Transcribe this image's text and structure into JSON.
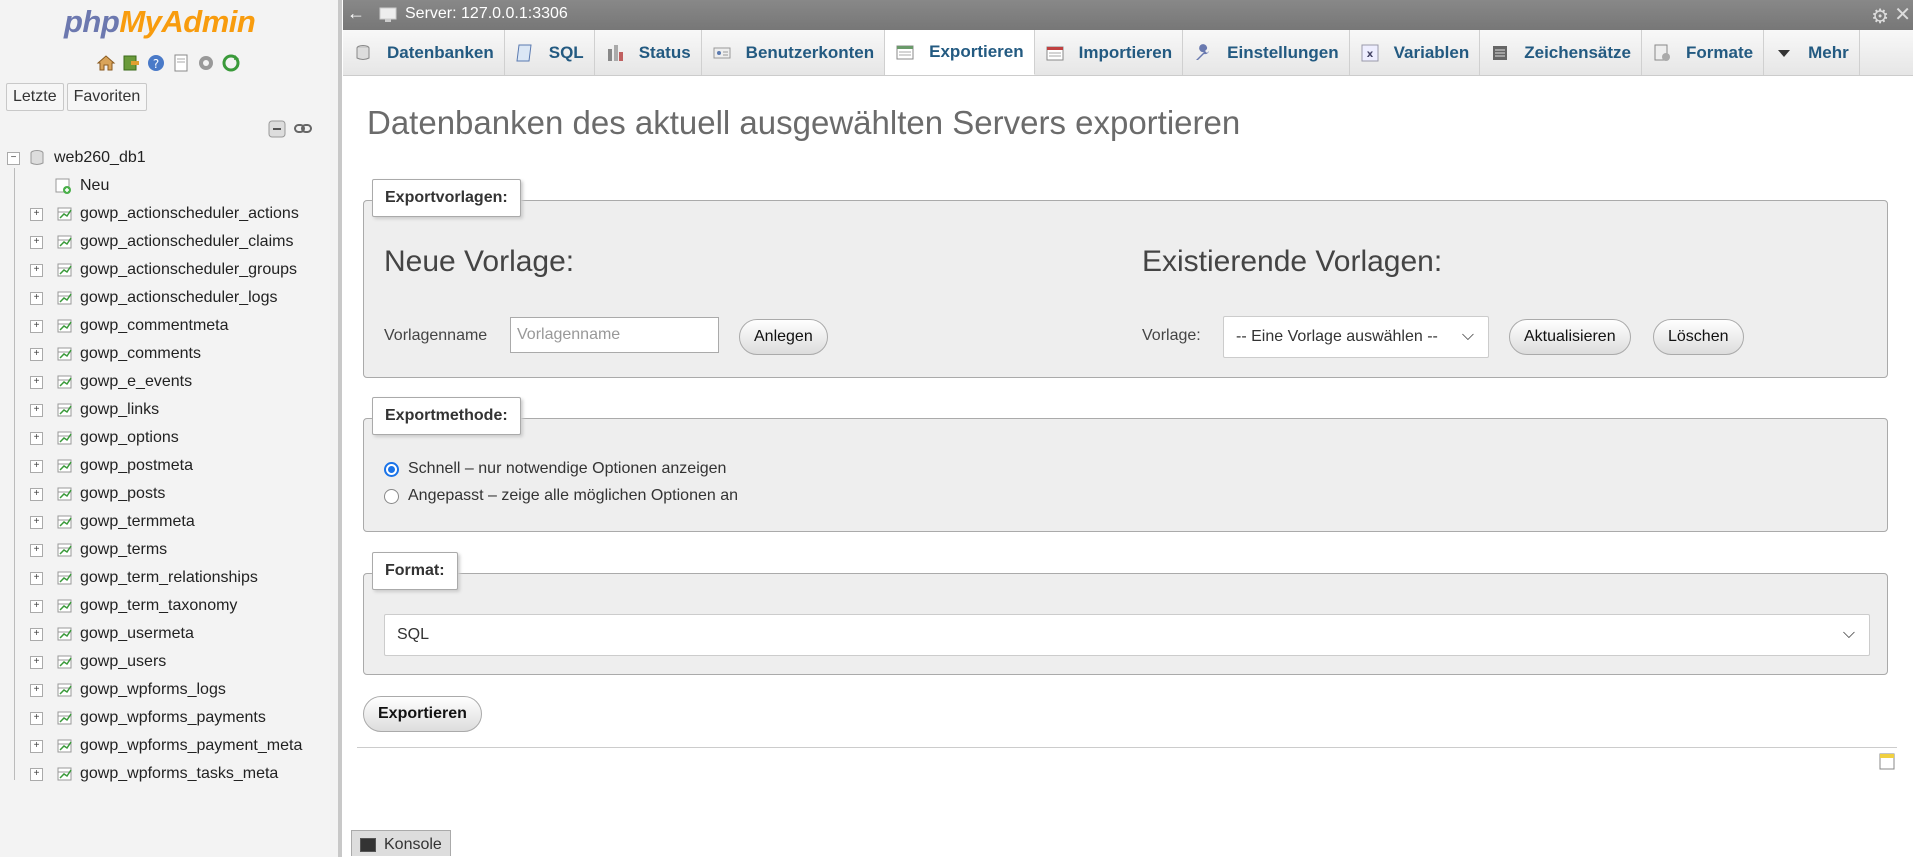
{
  "navigation": {
    "logo": {
      "part1": "php",
      "part2": "MyAdmin"
    },
    "tabs": [
      "Letzte",
      "Favoriten"
    ],
    "database": "web260_db1",
    "new_label": "Neu",
    "tables": [
      "gowp_actionscheduler_actions",
      "gowp_actionscheduler_claims",
      "gowp_actionscheduler_groups",
      "gowp_actionscheduler_logs",
      "gowp_commentmeta",
      "gowp_comments",
      "gowp_e_events",
      "gowp_links",
      "gowp_options",
      "gowp_postmeta",
      "gowp_posts",
      "gowp_termmeta",
      "gowp_terms",
      "gowp_term_relationships",
      "gowp_term_taxonomy",
      "gowp_usermeta",
      "gowp_users",
      "gowp_wpforms_logs",
      "gowp_wpforms_payments",
      "gowp_wpforms_payment_meta",
      "gowp_wpforms_tasks_meta"
    ]
  },
  "serverbar": {
    "back": "←",
    "server": "Server: 127.0.0.1:3306"
  },
  "menu": [
    {
      "label": "Datenbanken",
      "icon": "database-icon"
    },
    {
      "label": "SQL",
      "icon": "sql-icon"
    },
    {
      "label": "Status",
      "icon": "status-icon"
    },
    {
      "label": "Benutzerkonten",
      "icon": "users-icon"
    },
    {
      "label": "Exportieren",
      "icon": "export-icon",
      "active": true
    },
    {
      "label": "Importieren",
      "icon": "import-icon"
    },
    {
      "label": "Einstellungen",
      "icon": "wrench-icon"
    },
    {
      "label": "Variablen",
      "icon": "variables-icon"
    },
    {
      "label": "Zeichensätze",
      "icon": "charset-icon"
    },
    {
      "label": "Formate",
      "icon": "formats-icon"
    },
    {
      "label": "Mehr",
      "icon": "chevron-down-icon"
    }
  ],
  "page": {
    "title": "Datenbanken des aktuell ausgewählten Servers exportieren"
  },
  "templates": {
    "legend": "Exportvorlagen:",
    "new_heading": "Neue Vorlage:",
    "name_label": "Vorlagenname",
    "name_placeholder": "Vorlagenname",
    "create_button": "Anlegen",
    "existing_heading": "Existierende Vorlagen:",
    "template_label": "Vorlage:",
    "template_select": "-- Eine Vorlage auswählen --",
    "update_button": "Aktualisieren",
    "delete_button": "Löschen"
  },
  "method": {
    "legend": "Exportmethode:",
    "quick": "Schnell – nur notwendige Optionen anzeigen",
    "custom": "Angepasst – zeige alle möglichen Optionen an",
    "selected": "quick"
  },
  "format": {
    "legend": "Format:",
    "value": "SQL"
  },
  "export_button": "Exportieren",
  "console": {
    "label": "Konsole"
  },
  "colors": {
    "link": "#235a81",
    "accent": "#1a73e8",
    "logo_php": "#6c78af",
    "logo_myadmin": "#f89c0e"
  }
}
